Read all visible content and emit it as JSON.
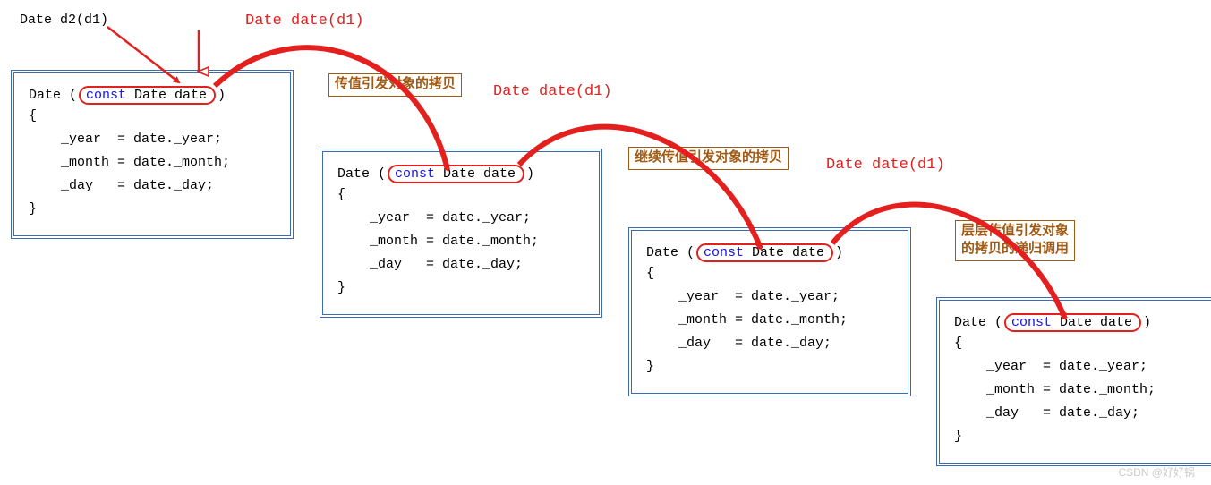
{
  "src_decl": "Date d2(d1)",
  "labels": {
    "call1": "Date date(d1)",
    "call2": "Date date(d1)",
    "call3": "Date date(d1)",
    "note1": "传值引发对象的拷贝",
    "note2": "继续传值引发对象的拷贝",
    "note3": "层层传值引发对象\n的拷贝的递归调用"
  },
  "code": {
    "sig_prefix": "Date (",
    "sig_const": "const",
    "sig_rest": " Date date",
    "sig_close": ")",
    "body": "{\n    _year  = date._year;\n    _month = date._month;\n    _day   = date._day;\n}"
  },
  "watermark": "CSDN @好好锅"
}
